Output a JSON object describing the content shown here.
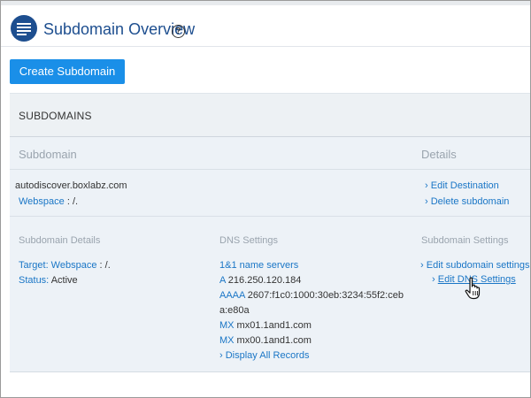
{
  "header": {
    "title": "Subdomain Overview",
    "help": "?"
  },
  "toolbar": {
    "create_label": "Create Subdomain"
  },
  "panel": {
    "title": "SUBDOMAINS",
    "columns": {
      "subdomain": "Subdomain",
      "details": "Details"
    }
  },
  "row": {
    "name": "autodiscover.boxlabz.com",
    "webspace_label": "Webspace",
    "webspace_value": " : /.",
    "actions": {
      "edit_destination": "Edit Destination",
      "delete_subdomain": "Delete subdomain"
    }
  },
  "details": {
    "subdomain_details": {
      "heading": "Subdomain Details",
      "target_label": "Target: Webspace",
      "target_value": " : /.",
      "status_label": "Status:",
      "status_value": " Active"
    },
    "dns": {
      "heading": "DNS Settings",
      "name_servers": "1&1 name servers",
      "a_type": "A",
      "a_value": " 216.250.120.184",
      "aaaa_type": "AAAA",
      "aaaa_value_1": " 2607:f1c0:1000:30eb:3234:55f2:ceb",
      "aaaa_value_2": "a:e80a",
      "mx1_type": "MX",
      "mx1_value": " mx01.1and1.com",
      "mx2_type": "MX",
      "mx2_value": " mx00.1and1.com",
      "display_all": "Display All Records"
    },
    "subdomain_settings": {
      "heading": "Subdomain Settings",
      "edit_subdomain": "Edit subdomain settings",
      "edit_dns": "Edit DNS Settings"
    }
  },
  "icons": {
    "chevron": "›",
    "cursor": "hand-pointer-icon"
  },
  "colors": {
    "brand": "#1d4e8f",
    "button": "#1a8fe8",
    "link": "#1a76c6"
  }
}
